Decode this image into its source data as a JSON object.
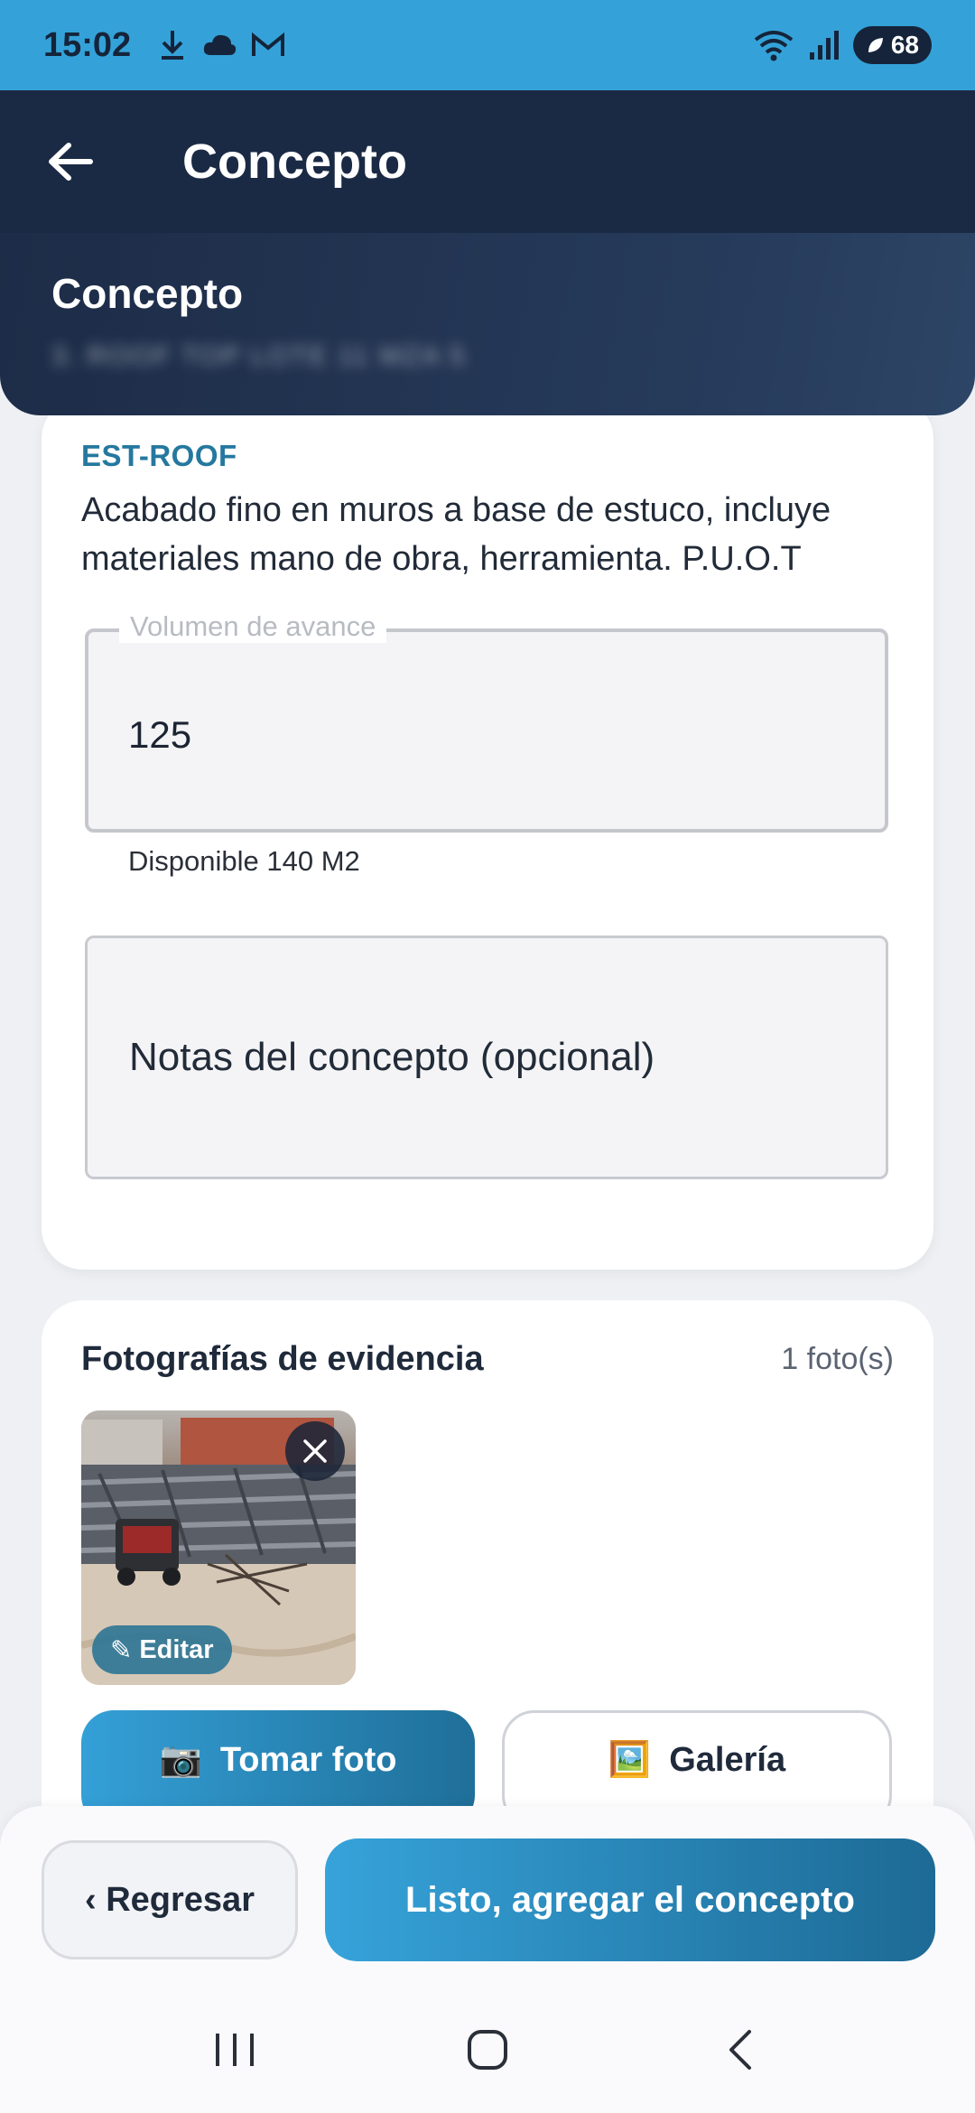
{
  "status_bar": {
    "time": "15:02",
    "battery_level": "68",
    "icons_left": [
      "download-icon",
      "cloud-icon",
      "gmail-icon"
    ],
    "icons_right": [
      "wifi-icon",
      "signal-icon",
      "battery-icon"
    ]
  },
  "app_bar": {
    "title": "Concepto"
  },
  "header": {
    "label": "Concepto",
    "subtitle": "3. ROOF TOP LOTE 11 MZA 5"
  },
  "concept": {
    "code": "EST-ROOF",
    "description": "Acabado fino en muros a base de estuco, incluye materiales mano de obra, herramienta. P.U.O.T"
  },
  "volume_field": {
    "label": "Volumen de avance",
    "value": "125",
    "helper": "Disponible 140 M2"
  },
  "notes_field": {
    "placeholder": "Notas del concepto (opcional)"
  },
  "evidence": {
    "title": "Fotografías de evidencia",
    "count": "1 foto(s)",
    "edit_label": "Editar",
    "edit_glyph": "✎",
    "take_photo_label": "Tomar foto",
    "take_photo_glyph": "📷",
    "gallery_label": "Galería",
    "gallery_glyph": "🖼️"
  },
  "actions": {
    "back_label": "‹ Regresar",
    "submit_label": "Listo, agregar el concepto"
  },
  "colors": {
    "status_bar": "#34a2d9",
    "app_bar": "#1b2a44",
    "accent": "#25789f",
    "primary_gradient_start": "#36a3da",
    "primary_gradient_end": "#1d6a95"
  }
}
